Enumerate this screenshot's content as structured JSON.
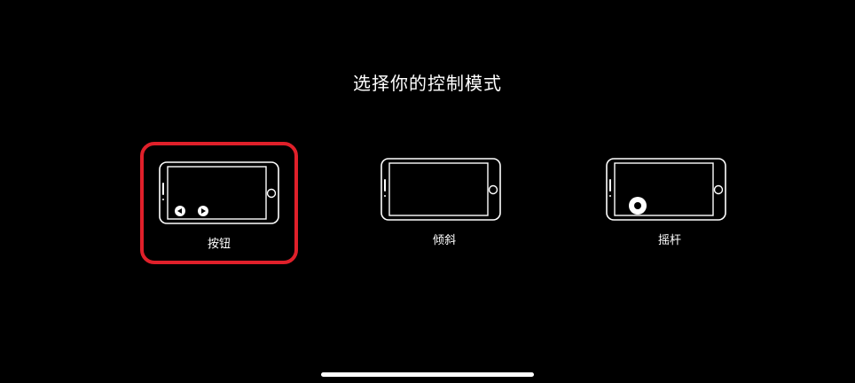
{
  "header": {
    "title": "选择你的控制模式"
  },
  "options": [
    {
      "id": "button",
      "label": "按钮",
      "selected": true
    },
    {
      "id": "tilt",
      "label": "倾斜",
      "selected": false
    },
    {
      "id": "joystick",
      "label": "摇杆",
      "selected": false
    }
  ],
  "colors": {
    "background": "#000000",
    "foreground": "#ffffff",
    "selection": "#e0202a"
  }
}
